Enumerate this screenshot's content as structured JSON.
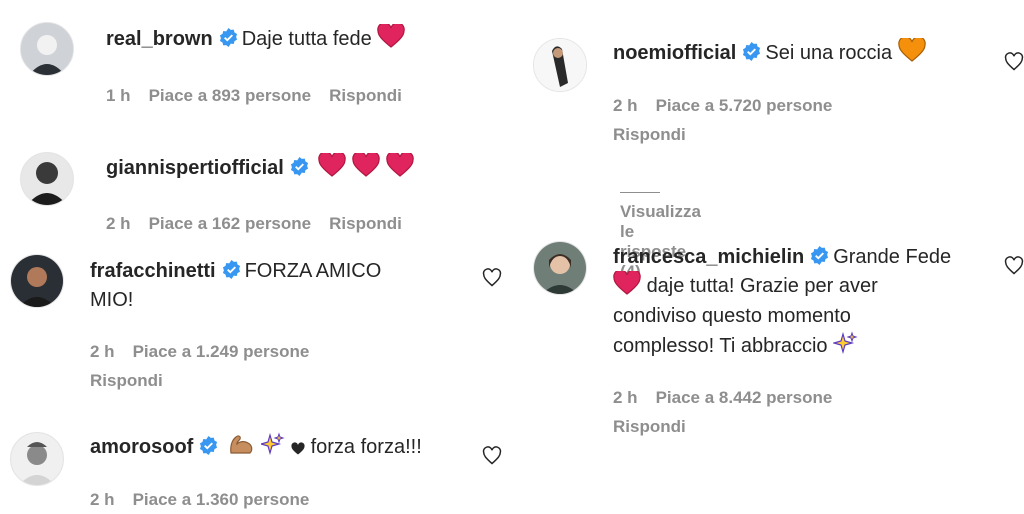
{
  "left": [
    {
      "username": "real_brown",
      "text": "Daje tutta fede",
      "time": "1 h",
      "likes": "Piace a 893 persone",
      "reply": "Rispondi"
    },
    {
      "username": "giannispertiofficial",
      "text": "",
      "time": "2 h",
      "likes": "Piace a 162 persone",
      "reply": "Rispondi"
    },
    {
      "username": "frafacchinetti",
      "text_line1": "FORZA AMICO",
      "text_line2": "MIO!",
      "time": "2 h",
      "likes": "Piace a 1.249 persone",
      "reply": "Rispondi"
    },
    {
      "username": "amorosoof",
      "text": "forza forza!!!",
      "time": "2 h",
      "likes": "Piace a 1.360 persone"
    }
  ],
  "right": [
    {
      "username": "noemiofficial",
      "text": "Sei una roccia",
      "time": "2 h",
      "likes": "Piace a 5.720 persone",
      "reply": "Rispondi",
      "view_replies": "Visualizza le risposte (4)"
    },
    {
      "username": "francesca_michielin",
      "text_line1": "Grande Fede",
      "text_line2": "daje tutta! Grazie per aver",
      "text_line3": "condiviso questo momento",
      "text_line4": "complesso! Ti abbraccio",
      "time": "2 h",
      "likes": "Piace a 8.442 persone",
      "reply": "Rispondi"
    }
  ],
  "colors": {
    "verified": "#3897f0",
    "red_heart": "#e0245e",
    "orange_heart": "#f4900c",
    "muted": "#8e8e8e"
  },
  "icons": [
    "verified-badge-icon",
    "heart-outline-icon",
    "red-heart-emoji",
    "orange-heart-emoji",
    "flexed-biceps-emoji",
    "sparkles-emoji",
    "black-heart-emoji"
  ]
}
